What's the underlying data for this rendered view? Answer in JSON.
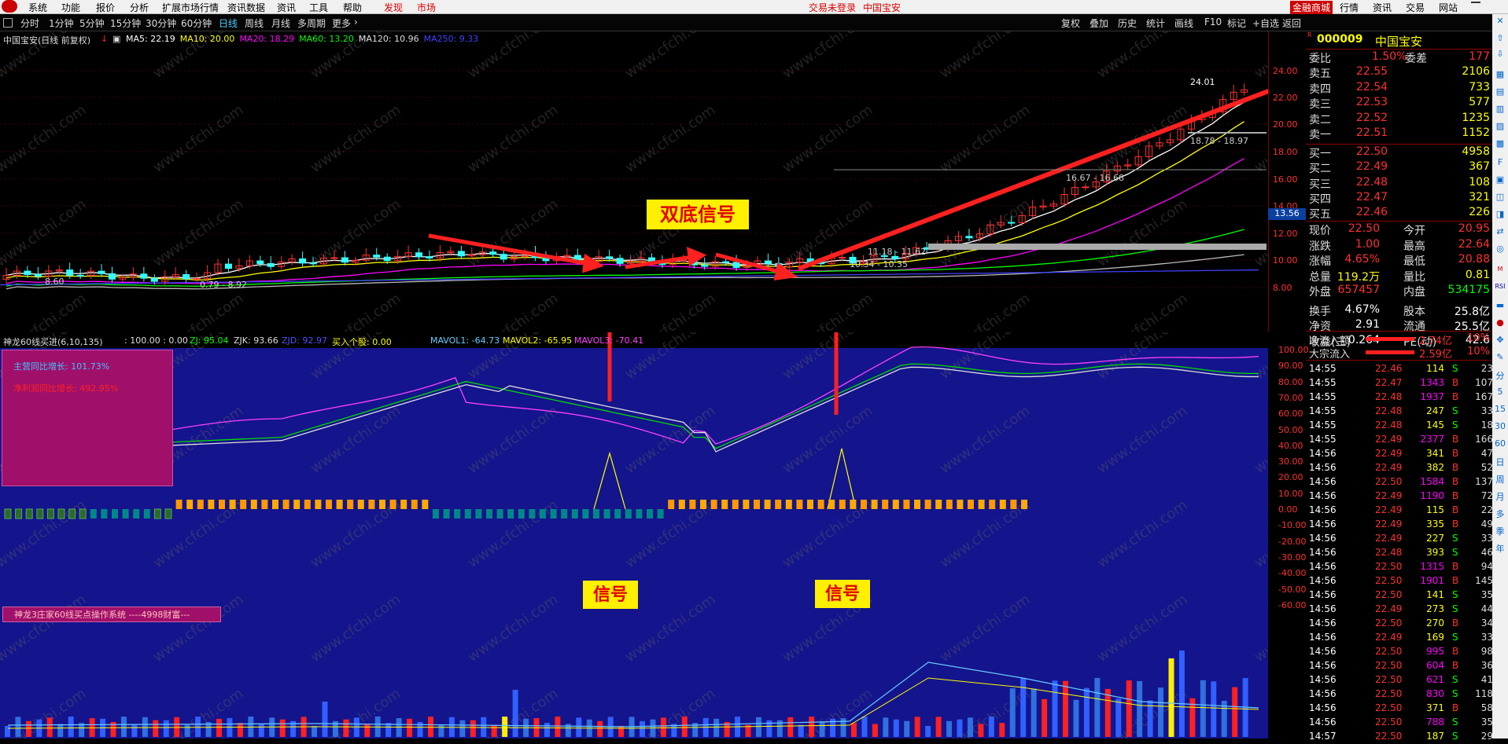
{
  "menu": {
    "items": [
      "系统",
      "功能",
      "报价",
      "分析",
      "扩展市场行情",
      "资讯数据",
      "资讯",
      "工具",
      "帮助"
    ],
    "discover": "发现",
    "market": "市场",
    "status": "交易未登录",
    "title_center": "中国宝安",
    "right": [
      "金融商城",
      "行情",
      "资讯",
      "交易",
      "网站"
    ]
  },
  "toolbar": {
    "timeframes": [
      "分时",
      "1分钟",
      "5分钟",
      "15分钟",
      "30分钟",
      "60分钟",
      "日线",
      "周线",
      "月线",
      "多周期",
      "更多"
    ],
    "active": "日线",
    "tools": [
      "复权",
      "叠加",
      "历史",
      "统计",
      "画线",
      "F10",
      "标记",
      "+自选",
      "返回"
    ]
  },
  "chart": {
    "title": "中国宝安(日线 前复权)",
    "ma": [
      {
        "label": "MA5: 22.19",
        "color": "#ffffff"
      },
      {
        "label": "MA10: 20.00",
        "color": "#ffff00"
      },
      {
        "label": "MA20: 18.29",
        "color": "#ff00ff"
      },
      {
        "label": "MA60: 13.20",
        "color": "#00ff00"
      },
      {
        "label": "MA120: 10.96",
        "color": "#dddddd"
      },
      {
        "label": "MA250: 9.33",
        "color": "#4040ff"
      }
    ],
    "y_ticks": [
      "24.00",
      "22.00",
      "20.00",
      "18.00",
      "16.00",
      "14.00",
      "12.00",
      "10.00",
      "8.00"
    ],
    "current_price_tag": "13.56",
    "annotations": {
      "double_bottom": "双底信号",
      "signal1": "信号",
      "signal2": "信号",
      "peak": "24.01",
      "range1": "18.78 - 18.97",
      "range2": "16.67 - 16.68",
      "range3": "11.18 - 11.62",
      "range4": "10.34 - 10.35",
      "range5": "0.79 - 8.92",
      "low": "8.60"
    },
    "watermark": "www.cfchi.com"
  },
  "indicator": {
    "name": "神龙60线买进(6,10,135)",
    "values": ": 100.00 : 0.00",
    "zj": "ZJ: 95.04",
    "zjk": "ZJK: 93.66",
    "zjd": "ZJD: 92.97",
    "buy": "买入个股: 0.00",
    "mavol1": "MAVOL1: -64.73",
    "mavol2": "MAVOL2: -65.95",
    "mavol3": "MAVOL3: -70.41",
    "y_ticks": [
      "100.00",
      "90.00",
      "80.00",
      "70.00",
      "60.00",
      "50.00",
      "40.00",
      "30.00",
      "20.00",
      "10.00",
      "0.00",
      "-10.00",
      "-20.00",
      "-30.00",
      "-40.00",
      "-50.00",
      "-60.00"
    ],
    "box_line1": "主营同比增长: 101.73%",
    "box_line2": "净利润同比增长: 492.95%",
    "system_label": "神龙3庄家60线买点操作系统 ----4998财富---"
  },
  "quote": {
    "code": "000009",
    "name": "中国宝安",
    "weibi_label": "委比",
    "weibi": "1.50%",
    "weicha_label": "委差",
    "weicha": "177",
    "sells": [
      {
        "label": "卖五",
        "price": "22.55",
        "vol": "2106"
      },
      {
        "label": "卖四",
        "price": "22.54",
        "vol": "733"
      },
      {
        "label": "卖三",
        "price": "22.53",
        "vol": "577"
      },
      {
        "label": "卖二",
        "price": "22.52",
        "vol": "1235"
      },
      {
        "label": "卖一",
        "price": "22.51",
        "vol": "1152"
      }
    ],
    "buys": [
      {
        "label": "买一",
        "price": "22.50",
        "vol": "4958"
      },
      {
        "label": "买二",
        "price": "22.49",
        "vol": "367"
      },
      {
        "label": "买三",
        "price": "22.48",
        "vol": "108"
      },
      {
        "label": "买四",
        "price": "22.47",
        "vol": "321"
      },
      {
        "label": "买五",
        "price": "22.46",
        "vol": "226"
      }
    ],
    "stats": [
      {
        "l1": "现价",
        "v1": "22.50",
        "c1": "#ff3030",
        "l2": "今开",
        "v2": "20.95",
        "c2": "#ff3030"
      },
      {
        "l1": "涨跌",
        "v1": "1.00",
        "c1": "#ff3030",
        "l2": "最高",
        "v2": "22.64",
        "c2": "#ff3030"
      },
      {
        "l1": "涨幅",
        "v1": "4.65%",
        "c1": "#ff3030",
        "l2": "最低",
        "v2": "20.88",
        "c2": "#ff3030"
      },
      {
        "l1": "总量",
        "v1": "119.2万",
        "c1": "#ffff00",
        "l2": "量比",
        "v2": "0.81",
        "c2": "#ffff00"
      },
      {
        "l1": "外盘",
        "v1": "657457",
        "c1": "#ff3030",
        "l2": "内盘",
        "v2": "534175",
        "c2": "#00ff00"
      },
      {
        "l1": "换手",
        "v1": "4.67%",
        "c1": "#ffffff",
        "l2": "股本",
        "v2": "25.8亿",
        "c2": "#ffffff"
      },
      {
        "l1": "净资",
        "v1": "2.91",
        "c1": "#ffffff",
        "l2": "流通",
        "v2": "25.5亿",
        "c2": "#ffffff"
      },
      {
        "l1": "收益(三)",
        "v1": "0.264",
        "c1": "#ffffff",
        "l2": "PE(动)",
        "v2": "42.6",
        "c2": "#ffffff"
      }
    ],
    "netflow": [
      {
        "label": "净流入额",
        "value": "2.74亿",
        "pct": "10%"
      },
      {
        "label": "大宗流入",
        "value": "2.59亿",
        "pct": "10%"
      }
    ],
    "trades": [
      {
        "t": "14:55",
        "p": "22.46",
        "pc": "#ff3030",
        "v": "114",
        "vc": "#ffff00",
        "s": "S",
        "sc": "#00ff00",
        "n": "23"
      },
      {
        "t": "14:55",
        "p": "22.47",
        "pc": "#ff3030",
        "v": "1343",
        "vc": "#ff00ff",
        "s": "B",
        "sc": "#ff3030",
        "n": "107"
      },
      {
        "t": "14:55",
        "p": "22.48",
        "pc": "#ff3030",
        "v": "1937",
        "vc": "#ff00ff",
        "s": "B",
        "sc": "#ff3030",
        "n": "167"
      },
      {
        "t": "14:55",
        "p": "22.48",
        "pc": "#ff3030",
        "v": "247",
        "vc": "#ffff00",
        "s": "S",
        "sc": "#00ff00",
        "n": "33"
      },
      {
        "t": "14:55",
        "p": "22.48",
        "pc": "#ff3030",
        "v": "145",
        "vc": "#ffff00",
        "s": "S",
        "sc": "#00ff00",
        "n": "18"
      },
      {
        "t": "14:55",
        "p": "22.49",
        "pc": "#ff3030",
        "v": "2377",
        "vc": "#ff00ff",
        "s": "B",
        "sc": "#ff3030",
        "n": "166"
      },
      {
        "t": "14:56",
        "p": "22.49",
        "pc": "#ff3030",
        "v": "341",
        "vc": "#ffff00",
        "s": "B",
        "sc": "#ff3030",
        "n": "47"
      },
      {
        "t": "14:56",
        "p": "22.49",
        "pc": "#ff3030",
        "v": "382",
        "vc": "#ffff00",
        "s": "B",
        "sc": "#ff3030",
        "n": "52"
      },
      {
        "t": "14:56",
        "p": "22.50",
        "pc": "#ff3030",
        "v": "1584",
        "vc": "#ff00ff",
        "s": "B",
        "sc": "#ff3030",
        "n": "137"
      },
      {
        "t": "14:56",
        "p": "22.49",
        "pc": "#ff3030",
        "v": "1190",
        "vc": "#ff00ff",
        "s": "B",
        "sc": "#ff3030",
        "n": "72"
      },
      {
        "t": "14:56",
        "p": "22.49",
        "pc": "#ff3030",
        "v": "115",
        "vc": "#ffff00",
        "s": "B",
        "sc": "#ff3030",
        "n": "22"
      },
      {
        "t": "14:56",
        "p": "22.49",
        "pc": "#ff3030",
        "v": "335",
        "vc": "#ffff00",
        "s": "B",
        "sc": "#ff3030",
        "n": "49"
      },
      {
        "t": "14:56",
        "p": "22.49",
        "pc": "#ff3030",
        "v": "227",
        "vc": "#ffff00",
        "s": "S",
        "sc": "#00ff00",
        "n": "33"
      },
      {
        "t": "14:56",
        "p": "22.48",
        "pc": "#ff3030",
        "v": "393",
        "vc": "#ffff00",
        "s": "S",
        "sc": "#00ff00",
        "n": "46"
      },
      {
        "t": "14:56",
        "p": "22.50",
        "pc": "#ff3030",
        "v": "1315",
        "vc": "#ff00ff",
        "s": "B",
        "sc": "#ff3030",
        "n": "94"
      },
      {
        "t": "14:56",
        "p": "22.50",
        "pc": "#ff3030",
        "v": "1901",
        "vc": "#ff00ff",
        "s": "B",
        "sc": "#ff3030",
        "n": "145"
      },
      {
        "t": "14:56",
        "p": "22.50",
        "pc": "#ff3030",
        "v": "141",
        "vc": "#ffff00",
        "s": "S",
        "sc": "#00ff00",
        "n": "35"
      },
      {
        "t": "14:56",
        "p": "22.49",
        "pc": "#ff3030",
        "v": "273",
        "vc": "#ffff00",
        "s": "S",
        "sc": "#00ff00",
        "n": "44"
      },
      {
        "t": "14:56",
        "p": "22.50",
        "pc": "#ff3030",
        "v": "270",
        "vc": "#ffff00",
        "s": "B",
        "sc": "#ff3030",
        "n": "34"
      },
      {
        "t": "14:56",
        "p": "22.49",
        "pc": "#ff3030",
        "v": "169",
        "vc": "#ffff00",
        "s": "S",
        "sc": "#00ff00",
        "n": "33"
      },
      {
        "t": "14:56",
        "p": "22.50",
        "pc": "#ff3030",
        "v": "995",
        "vc": "#ff00ff",
        "s": "B",
        "sc": "#ff3030",
        "n": "98"
      },
      {
        "t": "14:56",
        "p": "22.50",
        "pc": "#ff3030",
        "v": "604",
        "vc": "#ff00ff",
        "s": "B",
        "sc": "#ff3030",
        "n": "36"
      },
      {
        "t": "14:56",
        "p": "22.50",
        "pc": "#ff3030",
        "v": "621",
        "vc": "#ff00ff",
        "s": "S",
        "sc": "#00ff00",
        "n": "41"
      },
      {
        "t": "14:56",
        "p": "22.50",
        "pc": "#ff3030",
        "v": "830",
        "vc": "#ff00ff",
        "s": "S",
        "sc": "#00ff00",
        "n": "118"
      },
      {
        "t": "14:56",
        "p": "22.50",
        "pc": "#ff3030",
        "v": "371",
        "vc": "#ffff00",
        "s": "B",
        "sc": "#ff3030",
        "n": "58"
      },
      {
        "t": "14:56",
        "p": "22.50",
        "pc": "#ff3030",
        "v": "788",
        "vc": "#ff00ff",
        "s": "S",
        "sc": "#00ff00",
        "n": "35"
      },
      {
        "t": "14:57",
        "p": "22.50",
        "pc": "#ff3030",
        "v": "187",
        "vc": "#ffff00",
        "s": "S",
        "sc": "#00ff00",
        "n": "29"
      }
    ]
  },
  "right_sidebar": [
    "分",
    "5",
    "15",
    "30",
    "60",
    "日",
    "周",
    "月",
    "多",
    "季",
    "年"
  ]
}
